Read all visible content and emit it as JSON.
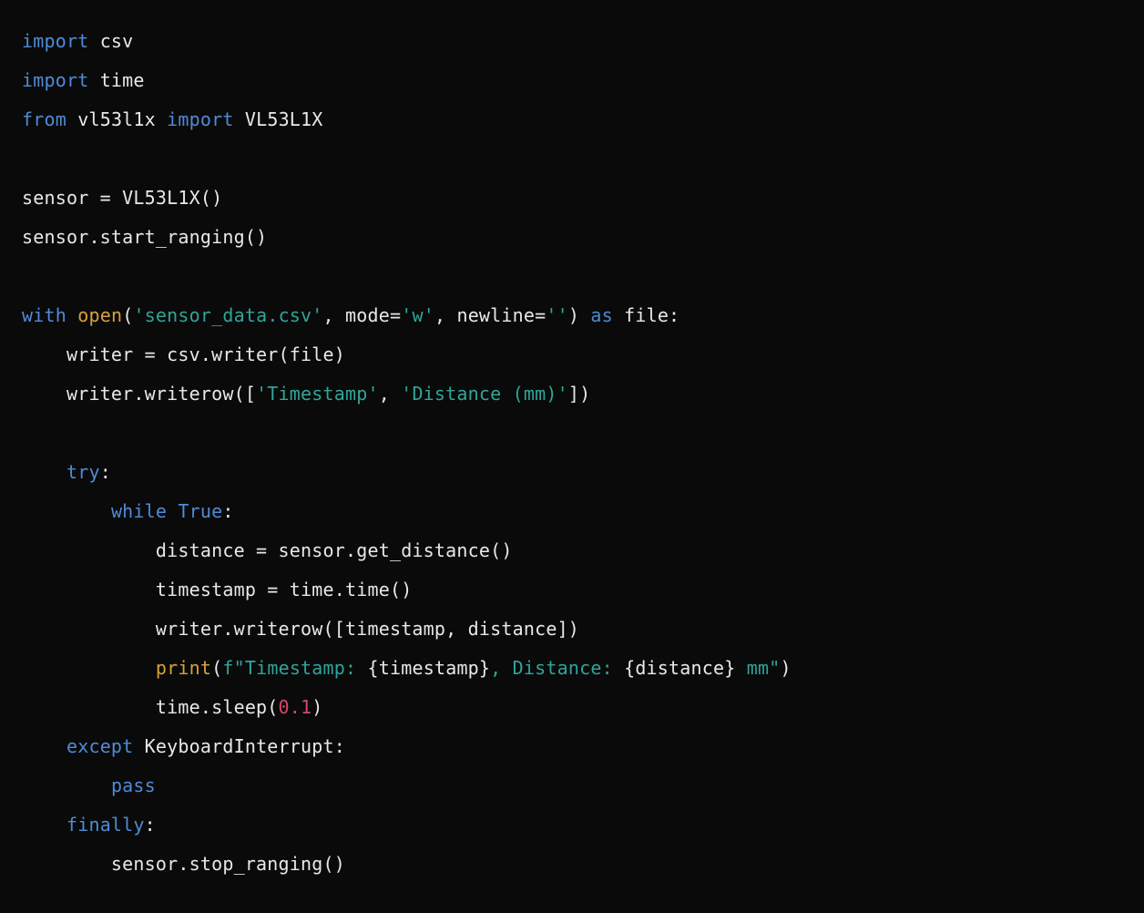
{
  "code": {
    "lines": [
      [
        {
          "t": "import ",
          "c": "kw"
        },
        {
          "t": "csv",
          "c": "id"
        }
      ],
      [
        {
          "t": "import ",
          "c": "kw"
        },
        {
          "t": "time",
          "c": "id"
        }
      ],
      [
        {
          "t": "from ",
          "c": "kw"
        },
        {
          "t": "vl53l1x ",
          "c": "id"
        },
        {
          "t": "import ",
          "c": "kw"
        },
        {
          "t": "VL53L1X",
          "c": "id"
        }
      ],
      [],
      [
        {
          "t": "sensor = VL53L1X()",
          "c": "id"
        }
      ],
      [
        {
          "t": "sensor.start_ranging()",
          "c": "id"
        }
      ],
      [],
      [
        {
          "t": "with ",
          "c": "kw"
        },
        {
          "t": "open",
          "c": "fn"
        },
        {
          "t": "(",
          "c": "id"
        },
        {
          "t": "'sensor_data.csv'",
          "c": "str"
        },
        {
          "t": ", mode=",
          "c": "id"
        },
        {
          "t": "'w'",
          "c": "str"
        },
        {
          "t": ", newline=",
          "c": "id"
        },
        {
          "t": "''",
          "c": "str"
        },
        {
          "t": ") ",
          "c": "id"
        },
        {
          "t": "as ",
          "c": "kw"
        },
        {
          "t": "file:",
          "c": "id"
        }
      ],
      [
        {
          "t": "    writer = csv.writer(file)",
          "c": "id"
        }
      ],
      [
        {
          "t": "    writer.writerow([",
          "c": "id"
        },
        {
          "t": "'Timestamp'",
          "c": "str"
        },
        {
          "t": ", ",
          "c": "id"
        },
        {
          "t": "'Distance (mm)'",
          "c": "str"
        },
        {
          "t": "])",
          "c": "id"
        }
      ],
      [],
      [
        {
          "t": "    ",
          "c": "id"
        },
        {
          "t": "try",
          "c": "kw"
        },
        {
          "t": ":",
          "c": "id"
        }
      ],
      [
        {
          "t": "        ",
          "c": "id"
        },
        {
          "t": "while ",
          "c": "kw"
        },
        {
          "t": "True",
          "c": "kw"
        },
        {
          "t": ":",
          "c": "id"
        }
      ],
      [
        {
          "t": "            distance = sensor.get_distance()",
          "c": "id"
        }
      ],
      [
        {
          "t": "            timestamp = time.time()",
          "c": "id"
        }
      ],
      [
        {
          "t": "            writer.writerow([timestamp, distance])",
          "c": "id"
        }
      ],
      [
        {
          "t": "            ",
          "c": "id"
        },
        {
          "t": "print",
          "c": "fn"
        },
        {
          "t": "(",
          "c": "id"
        },
        {
          "t": "f\"Timestamp: ",
          "c": "fstr"
        },
        {
          "t": "{timestamp}",
          "c": "fexp"
        },
        {
          "t": ", Distance: ",
          "c": "fstr"
        },
        {
          "t": "{distance}",
          "c": "fexp"
        },
        {
          "t": " mm\"",
          "c": "fstr"
        },
        {
          "t": ")",
          "c": "id"
        }
      ],
      [
        {
          "t": "            time.sleep(",
          "c": "id"
        },
        {
          "t": "0.1",
          "c": "num"
        },
        {
          "t": ")",
          "c": "id"
        }
      ],
      [
        {
          "t": "    ",
          "c": "id"
        },
        {
          "t": "except ",
          "c": "kw"
        },
        {
          "t": "KeyboardInterrupt:",
          "c": "id"
        }
      ],
      [
        {
          "t": "        ",
          "c": "id"
        },
        {
          "t": "pass",
          "c": "kw"
        }
      ],
      [
        {
          "t": "    ",
          "c": "id"
        },
        {
          "t": "finally",
          "c": "kw"
        },
        {
          "t": ":",
          "c": "id"
        }
      ],
      [
        {
          "t": "        sensor.stop_ranging()",
          "c": "id"
        }
      ]
    ]
  }
}
